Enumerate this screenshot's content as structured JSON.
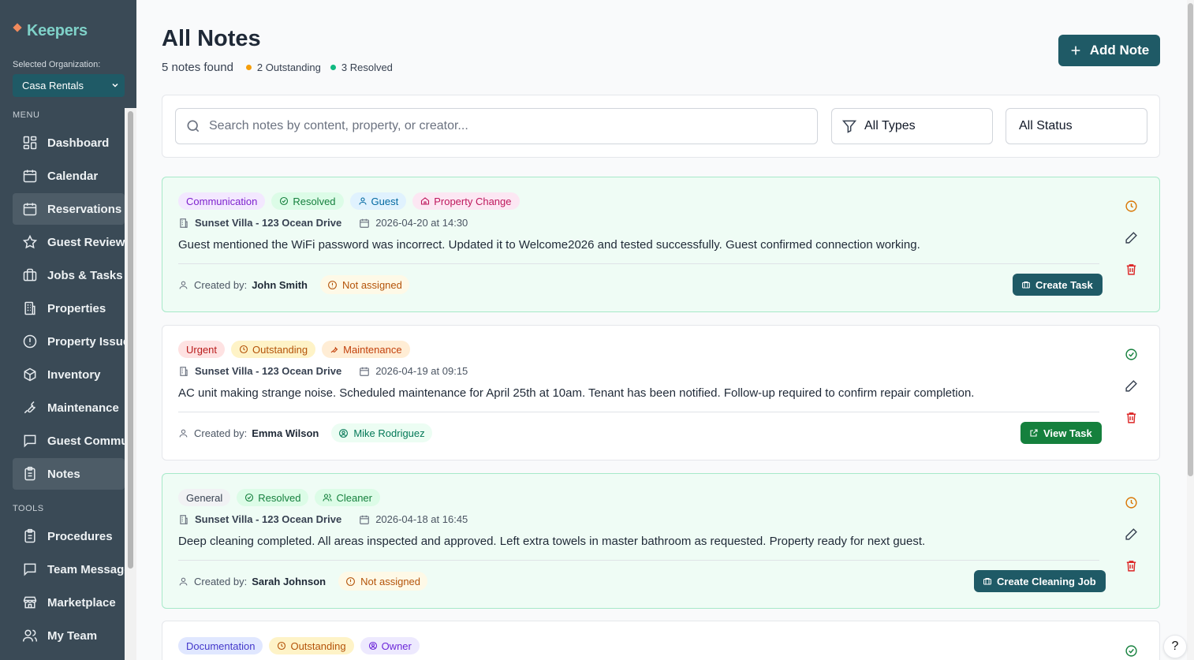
{
  "sidebar": {
    "brand": "Keepers",
    "org_label": "Selected Organization:",
    "org_value": "Casa Rentals",
    "menu_label": "MENU",
    "tools_label": "TOOLS",
    "menu_items": [
      {
        "label": "Dashboard",
        "icon": "dashboard-icon"
      },
      {
        "label": "Calendar",
        "icon": "calendar-icon"
      },
      {
        "label": "Reservations",
        "icon": "reservations-icon"
      },
      {
        "label": "Guest Reviews",
        "icon": "star-icon"
      },
      {
        "label": "Jobs & Tasks",
        "icon": "briefcase-icon"
      },
      {
        "label": "Properties",
        "icon": "building-icon"
      },
      {
        "label": "Property Issues",
        "icon": "alert-circle-icon"
      },
      {
        "label": "Inventory",
        "icon": "box-icon"
      },
      {
        "label": "Maintenance",
        "icon": "wrench-icon"
      },
      {
        "label": "Guest Communication",
        "icon": "message-icon"
      },
      {
        "label": "Notes",
        "icon": "clipboard-icon"
      }
    ],
    "tool_items": [
      {
        "label": "Procedures",
        "icon": "procedures-icon"
      },
      {
        "label": "Team Messages",
        "icon": "message-icon"
      },
      {
        "label": "Marketplace",
        "icon": "store-icon"
      },
      {
        "label": "My Team",
        "icon": "users-icon"
      }
    ]
  },
  "header": {
    "title": "All Notes",
    "count": "5 notes found",
    "outstanding": "2 Outstanding",
    "resolved": "3 Resolved",
    "add_button": "Add Note"
  },
  "filters": {
    "search_placeholder": "Search notes by content, property, or creator...",
    "types": "All Types",
    "status": "All Status"
  },
  "notes": [
    {
      "tags": [
        "Communication",
        "Resolved",
        "Guest",
        "Property Change"
      ],
      "property": "Sunset Villa - 123 Ocean Drive",
      "date": "2026-04-20 at 14:30",
      "content": "Guest mentioned the WiFi password was incorrect. Updated it to Welcome2026 and tested successfully. Guest confirmed connection working.",
      "created_label": "Created by:",
      "creator": "John Smith",
      "assignee": "Not assigned",
      "action": "Create Task"
    },
    {
      "tags": [
        "Urgent",
        "Outstanding",
        "Maintenance"
      ],
      "property": "Sunset Villa - 123 Ocean Drive",
      "date": "2026-04-19 at 09:15",
      "content": "AC unit making strange noise. Scheduled maintenance for April 25th at 10am. Tenant has been notified. Follow-up required to confirm repair completion.",
      "created_label": "Created by:",
      "creator": "Emma Wilson",
      "assignee": "Mike Rodriguez",
      "action": "View Task"
    },
    {
      "tags": [
        "General",
        "Resolved",
        "Cleaner"
      ],
      "property": "Sunset Villa - 123 Ocean Drive",
      "date": "2026-04-18 at 16:45",
      "content": "Deep cleaning completed. All areas inspected and approved. Left extra towels in master bathroom as requested. Property ready for next guest.",
      "created_label": "Created by:",
      "creator": "Sarah Johnson",
      "assignee": "Not assigned",
      "action": "Create Cleaning Job"
    },
    {
      "tags": [
        "Documentation",
        "Outstanding",
        "Owner"
      ]
    }
  ],
  "help": "?",
  "colors": {
    "primary": "#1f5a66",
    "sidebar": "#3a4a56",
    "green": "#15803d",
    "delete": "#dc2626",
    "outstanding": "#f59e0b",
    "resolved_dot": "#10b981"
  }
}
